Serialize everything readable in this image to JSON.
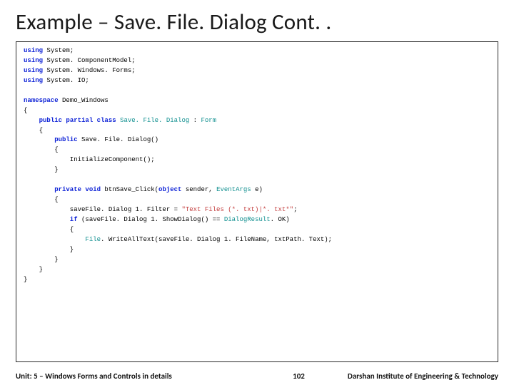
{
  "title": "Example – Save. File. Dialog Cont. .",
  "code": {
    "l01a": "using",
    "l01b": " System;",
    "l02a": "using",
    "l02b": " System. ComponentModel;",
    "l03a": "using",
    "l03b": " System. Windows. Forms;",
    "l04a": "using",
    "l04b": " System. IO;",
    "blank1": " ",
    "l05a": "namespace",
    "l05b": " Demo_Windows",
    "l06": "{",
    "l07a": "    public",
    "l07b": " partial",
    "l07c": " class",
    "l07d": " Save. File. Dialog",
    "l07e": " : ",
    "l07f": "Form",
    "l08": "    {",
    "l09a": "        public",
    "l09b": " Save. File. Dialog()",
    "l10": "        {",
    "l11": "            InitializeComponent();",
    "l12": "        }",
    "blank2": " ",
    "l13a": "        private",
    "l13b": " void",
    "l13c": " btnSave_Click(",
    "l13d": "object",
    "l13e": " sender, ",
    "l13f": "EventArgs",
    "l13g": " e)",
    "l14": "        {",
    "l15a": "            saveFile. Dialog 1. Filter = ",
    "l15b": "\"Text Files (*. txt)|*. txt*\"",
    "l15c": ";",
    "l16a": "            if",
    "l16b": " (saveFile. Dialog 1. ShowDialog() == ",
    "l16c": "DialogResult",
    "l16d": ". OK)",
    "l17": "            {",
    "l18a": "                File",
    "l18b": ". WriteAllText(saveFile. Dialog 1. FileName, txtPath. Text);",
    "l19": "            }",
    "l20": "        }",
    "l21": "    }",
    "l22": "}"
  },
  "footer": {
    "unit": "Unit: 5 – Windows Forms and Controls in details",
    "page": "102",
    "institute": "Darshan Institute of Engineering & Technology"
  }
}
